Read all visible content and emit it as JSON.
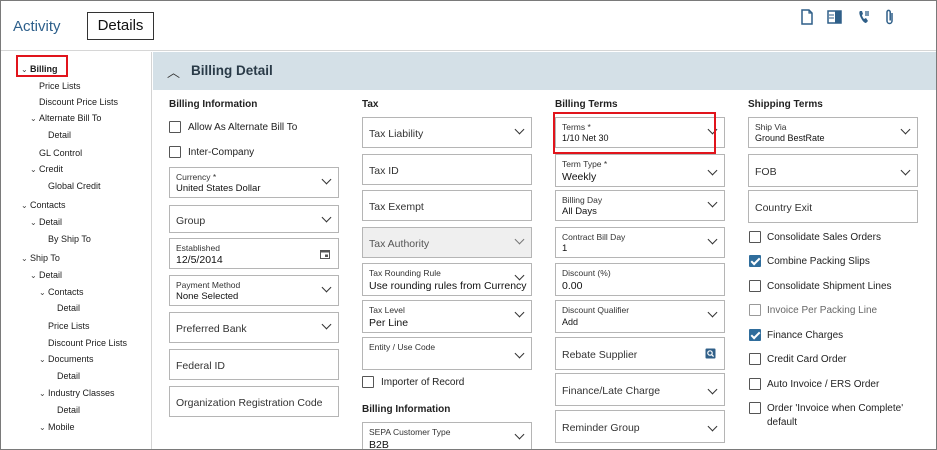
{
  "header": {
    "tab_activity": "Activity",
    "tab_details": "Details",
    "icons": [
      "document-icon",
      "layout-icon",
      "phone-icon",
      "paperclip-icon"
    ]
  },
  "sidebar": {
    "items": [
      {
        "label": "Billing",
        "chevron": true,
        "selected": true
      },
      {
        "label": "Price Lists"
      },
      {
        "label": "Discount Price Lists"
      },
      {
        "label": "Alternate Bill To",
        "chevron": true
      },
      {
        "label": "Detail"
      },
      {
        "label": "GL Control"
      },
      {
        "label": "Credit",
        "chevron": true
      },
      {
        "label": "Global Credit"
      },
      {
        "label": "Contacts",
        "chevron": true
      },
      {
        "label": "Detail",
        "chevron": true
      },
      {
        "label": "By Ship To"
      },
      {
        "label": "Ship To",
        "chevron": true
      },
      {
        "label": "Detail",
        "chevron": true
      },
      {
        "label": "Contacts",
        "chevron": true
      },
      {
        "label": "Detail"
      },
      {
        "label": "Price Lists"
      },
      {
        "label": "Discount Price Lists"
      },
      {
        "label": "Documents",
        "chevron": true
      },
      {
        "label": "Detail"
      },
      {
        "label": "Industry Classes",
        "chevron": true
      },
      {
        "label": "Detail"
      },
      {
        "label": "Mobile",
        "chevron": true
      }
    ]
  },
  "section": {
    "title": "Billing Detail"
  },
  "billing_info": {
    "title": "Billing Information",
    "allow_alt_bill_to": "Allow As Alternate Bill To",
    "inter_company": "Inter-Company",
    "currency_label": "Currency *",
    "currency_value": "United States Dollar",
    "group_placeholder": "Group",
    "established_label": "Established",
    "established_value": "12/5/2014",
    "payment_method_label": "Payment Method",
    "payment_method_value": "None Selected",
    "preferred_bank_placeholder": "Preferred Bank",
    "federal_id_placeholder": "Federal ID",
    "org_reg_code_placeholder": "Organization Registration Code"
  },
  "tax": {
    "title": "Tax",
    "tax_liability_placeholder": "Tax Liability",
    "tax_id_placeholder": "Tax ID",
    "tax_exempt_placeholder": "Tax Exempt",
    "tax_authority_placeholder": "Tax Authority",
    "rounding_rule_label": "Tax Rounding Rule",
    "rounding_rule_value": "Use rounding rules from Currency",
    "tax_level_label": "Tax Level",
    "tax_level_value": "Per Line",
    "entity_use_code_label": "Entity / Use Code",
    "importer_of_record": "Importer of Record",
    "billing_info_title": "Billing Information",
    "sepa_label": "SEPA Customer Type",
    "sepa_value": "B2B"
  },
  "billing_terms": {
    "title": "Billing Terms",
    "terms_label": "Terms *",
    "terms_value": "1/10 Net 30",
    "term_type_label": "Term Type *",
    "term_type_value": "Weekly",
    "billing_day_label": "Billing Day",
    "billing_day_value": "All Days",
    "contract_bill_day_label": "Contract Bill Day",
    "contract_bill_day_value": "1",
    "discount_pct_label": "Discount (%)",
    "discount_pct_value": "0.00",
    "discount_qualifier_label": "Discount Qualifier",
    "discount_qualifier_value": "Add",
    "rebate_supplier_placeholder": "Rebate Supplier",
    "finance_late_charge_placeholder": "Finance/Late Charge",
    "reminder_group_placeholder": "Reminder Group"
  },
  "shipping_terms": {
    "title": "Shipping Terms",
    "ship_via_label": "Ship Via",
    "ship_via_value": "Ground BestRate",
    "fob_placeholder": "FOB",
    "country_exit_placeholder": "Country Exit",
    "consolidate_sales_orders": "Consolidate Sales Orders",
    "combine_packing_slips": "Combine Packing Slips",
    "consolidate_shipment_lines": "Consolidate Shipment Lines",
    "invoice_per_packing_line": "Invoice Per Packing Line",
    "finance_charges": "Finance Charges",
    "credit_card_order": "Credit Card Order",
    "auto_invoice": "Auto Invoice / ERS Order",
    "order_invoice_when_complete_1": "Order 'Invoice when Complete'",
    "order_invoice_when_complete_2": "default"
  },
  "checkbox_states": {
    "allow_alt_bill_to": false,
    "inter_company": false,
    "importer_of_record": false,
    "consolidate_sales_orders": false,
    "combine_packing_slips": true,
    "consolidate_shipment_lines": false,
    "invoice_per_packing_line": false,
    "finance_charges": true,
    "credit_card_order": false,
    "auto_invoice": false,
    "order_invoice_when_complete": false
  },
  "colors": {
    "accent": "#2d5f8b",
    "checkbox_checked": "#2f6d9c",
    "highlight_box": "#e1141c",
    "section_background": "#d4e0e7"
  }
}
